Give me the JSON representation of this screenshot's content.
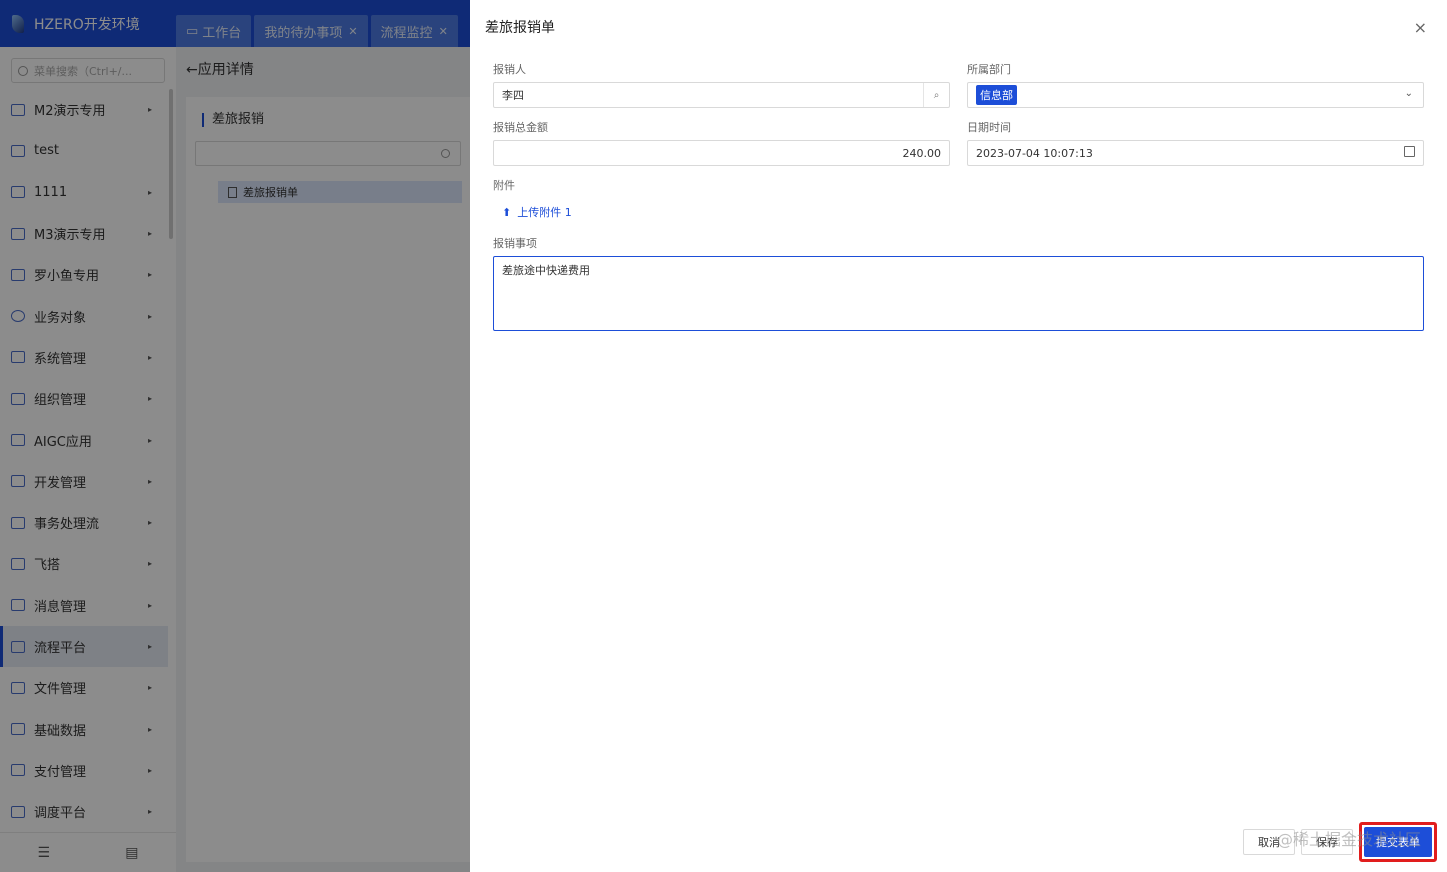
{
  "app": {
    "brand": "HZERO开发环境"
  },
  "tabs": [
    {
      "label": "工作台"
    },
    {
      "label": "我的待办事项"
    },
    {
      "label": "流程监控"
    }
  ],
  "sidebar": {
    "search_placeholder": "菜单搜索（Ctrl+/...",
    "items": [
      {
        "label": "M2演示专用"
      },
      {
        "label": "test"
      },
      {
        "label": "1111"
      },
      {
        "label": "M3演示专用"
      },
      {
        "label": "罗小鱼专用"
      },
      {
        "label": "业务对象"
      },
      {
        "label": "系统管理"
      },
      {
        "label": "组织管理"
      },
      {
        "label": "AIGC应用"
      },
      {
        "label": "开发管理"
      },
      {
        "label": "事务处理流"
      },
      {
        "label": "飞搭"
      },
      {
        "label": "消息管理"
      },
      {
        "label": "流程平台"
      },
      {
        "label": "文件管理"
      },
      {
        "label": "基础数据"
      },
      {
        "label": "支付管理"
      },
      {
        "label": "调度平台"
      }
    ]
  },
  "content": {
    "breadcrumb": "←应用详情",
    "panel_title": "差旅报销",
    "tree_node": "差旅报销单"
  },
  "drawer": {
    "title": "差旅报销单",
    "close_symbol": "×",
    "fields": {
      "applicant_label": "报销人",
      "applicant_value": "李四",
      "dept_label": "所属部门",
      "dept_value": "信息部",
      "amount_label": "报销总金额",
      "amount_value": "240.00",
      "datetime_label": "日期时间",
      "datetime_value": "2023-07-04 10:07:13",
      "attachment_label": "附件",
      "upload_label": "上传附件 1",
      "item_label": "报销事项",
      "item_value": "差旅途中快递费用"
    },
    "buttons": {
      "cancel": "取消",
      "save": "保存",
      "submit": "提交表单"
    },
    "watermark": "@稀土掘金技术社区"
  }
}
